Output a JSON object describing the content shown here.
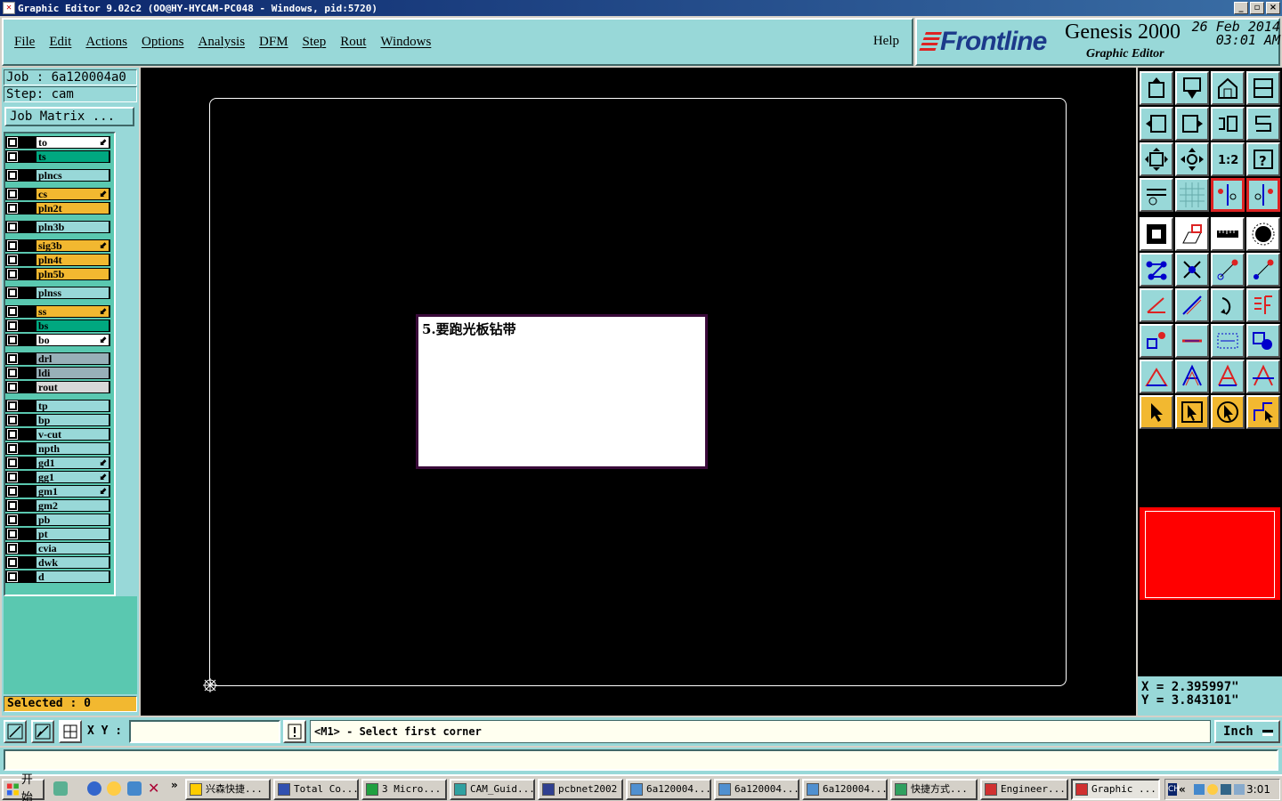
{
  "window": {
    "title": "Graphic Editor 9.02c2 (OO@HY-HYCAM-PC048 - Windows, pid:5720)",
    "controls": [
      "_",
      "▫",
      "×"
    ]
  },
  "menu": {
    "items": [
      "File",
      "Edit",
      "Actions",
      "Options",
      "Analysis",
      "DFM",
      "Step",
      "Rout",
      "Windows"
    ],
    "help": "Help"
  },
  "logo": {
    "brand": "Frontline",
    "product": "Genesis 2000",
    "subtitle": "Graphic Editor",
    "date": "26 Feb 2014",
    "time": "03:01 AM"
  },
  "job": {
    "job_label": "Job : 6a120004a0",
    "step_label": "Step: cam",
    "matrix_button": "Job Matrix ..."
  },
  "layers": [
    {
      "name": "to",
      "color": "#ffffff",
      "flag": "⬋"
    },
    {
      "name": "ts",
      "color": "#00a880",
      "flag": ""
    },
    {
      "name": "plncs",
      "color": "#98d8d8",
      "flag": ""
    },
    {
      "name": "cs",
      "color": "#f2b830",
      "flag": "⬋"
    },
    {
      "name": "pln2t",
      "color": "#f2b830",
      "flag": ""
    },
    {
      "name": "pln3b",
      "color": "#98d8d8",
      "flag": ""
    },
    {
      "name": "sig3b",
      "color": "#f2b830",
      "flag": "⬋"
    },
    {
      "name": "pln4t",
      "color": "#f2b830",
      "flag": ""
    },
    {
      "name": "pln5b",
      "color": "#f2b830",
      "flag": ""
    },
    {
      "name": "plnss",
      "color": "#98d8d8",
      "flag": ""
    },
    {
      "name": "ss",
      "color": "#f2b830",
      "flag": "⬋"
    },
    {
      "name": "bs",
      "color": "#00a880",
      "flag": ""
    },
    {
      "name": "bo",
      "color": "#ffffff",
      "flag": "⬋"
    },
    {
      "name": "drl",
      "color": "#98b0b8",
      "flag": ""
    },
    {
      "name": "ldi",
      "color": "#98b0b8",
      "flag": ""
    },
    {
      "name": "rout",
      "color": "#d8d8d8",
      "flag": ""
    },
    {
      "name": "tp",
      "color": "#98d8d8",
      "flag": ""
    },
    {
      "name": "bp",
      "color": "#98d8d8",
      "flag": ""
    },
    {
      "name": "v-cut",
      "color": "#98d8d8",
      "flag": ""
    },
    {
      "name": "npth",
      "color": "#98d8d8",
      "flag": ""
    },
    {
      "name": "gd1",
      "color": "#98d8d8",
      "flag": "⬋"
    },
    {
      "name": "gg1",
      "color": "#98d8d8",
      "flag": "⬋"
    },
    {
      "name": "gm1",
      "color": "#98d8d8",
      "flag": "⬋"
    },
    {
      "name": "gm2",
      "color": "#98d8d8",
      "flag": ""
    },
    {
      "name": "pb",
      "color": "#98d8d8",
      "flag": ""
    },
    {
      "name": "pt",
      "color": "#98d8d8",
      "flag": ""
    },
    {
      "name": "cvia",
      "color": "#98d8d8",
      "flag": ""
    },
    {
      "name": "dwk",
      "color": "#98d8d8",
      "flag": ""
    },
    {
      "name": "d",
      "color": "#98d8d8",
      "flag": ""
    }
  ],
  "selected": "Selected : 0",
  "note": "5.要跑光板钻带",
  "toolbar_icons": [
    "feature-up-icon",
    "feature-down-icon",
    "home-icon",
    "window-icon",
    "left-arrow-icon",
    "right-arrow-icon",
    "rotate-icon",
    "s-shape-icon",
    "zoom-fit-icon",
    "center-icon",
    "scale-1-2-icon",
    "help-icon",
    "graphic-params-icon",
    "grid-icon",
    "snap-left-icon",
    "snap-right-icon",
    "select-box-icon",
    "parallelogram-icon",
    "ruler-icon",
    "pad-icon",
    "vertex-icon",
    "delete-cross-icon",
    "connect-point-icon",
    "connect-arrow-icon",
    "angle-icon",
    "line-icon",
    "arc-icon",
    "text-f-icon",
    "pad-add-icon",
    "line-add-icon",
    "measure-icon",
    "shapes-icon",
    "triangle-icon",
    "letter-a-icon",
    "letter-a-box-icon",
    "letter-a-line-icon",
    "pointer-icon",
    "pointer-box-icon",
    "pointer-circle-icon",
    "route-path-icon"
  ],
  "toolbar_rows": [
    4,
    4,
    4,
    4,
    6,
    6,
    6,
    6,
    6,
    6
  ],
  "coords": {
    "x": "X = 2.395997\"",
    "y": "Y = 3.843101\""
  },
  "bottom": {
    "xy_label": "X Y :",
    "xy_value": "",
    "prompt": "<M1> - Select first corner",
    "units": "Inch"
  },
  "taskbar": {
    "start": "开始",
    "tasks": [
      {
        "label": "兴森快捷...",
        "color": "#ffcc00"
      },
      {
        "label": "Total Co...",
        "color": "#3050b0"
      },
      {
        "label": "3 Micro...",
        "color": "#20a040"
      },
      {
        "label": "CAM_Guid...",
        "color": "#30a0a0"
      },
      {
        "label": "pcbnet2002",
        "color": "#304090"
      },
      {
        "label": "6a120004...",
        "color": "#5090d0"
      },
      {
        "label": "6a120004...",
        "color": "#5090d0"
      },
      {
        "label": "6a120004...",
        "color": "#5090d0"
      },
      {
        "label": "快捷方式...",
        "color": "#30a060"
      },
      {
        "label": "Engineer...",
        "color": "#d03030"
      },
      {
        "label": "Graphic ...",
        "color": "#d03030"
      }
    ],
    "clock": "3:01"
  }
}
